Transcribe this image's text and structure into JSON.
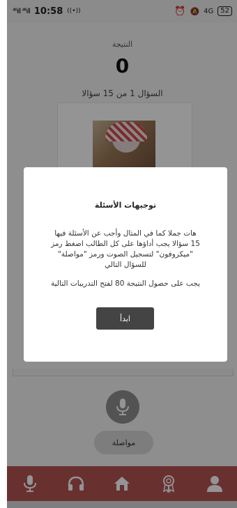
{
  "statusbar": {
    "time": "10:58",
    "signal": "⁴⁶ıll ⁴⁶ıll",
    "battery": "52",
    "network": "4G"
  },
  "quiz": {
    "score_label": "النتيجة",
    "score": "0",
    "progress": "السؤال 1 من 15 سؤالا"
  },
  "modal": {
    "title": "توجيهات الأسئلة",
    "body": "هات جملا كما في المثال وأجب عن الأسئلة فيها 15 سؤالا يجب أداؤها على كل الطالب اضغط رمز \"ميكروفون\" لتسجيل الصوت ورمز \"مواصلة\" للسؤال التالي",
    "requirement": "يجب على حصول النتيجة 80 لفتح التدريبات التالية",
    "start_label": "ابدأ"
  },
  "actions": {
    "continue_label": "مواصلة"
  },
  "nav": {
    "items": [
      "mic-icon",
      "headphones-icon",
      "home-icon",
      "award-icon",
      "user-icon"
    ],
    "bar_color": "#b55353"
  },
  "colors": {
    "accent": "#b55353",
    "button_dark": "#444444"
  }
}
